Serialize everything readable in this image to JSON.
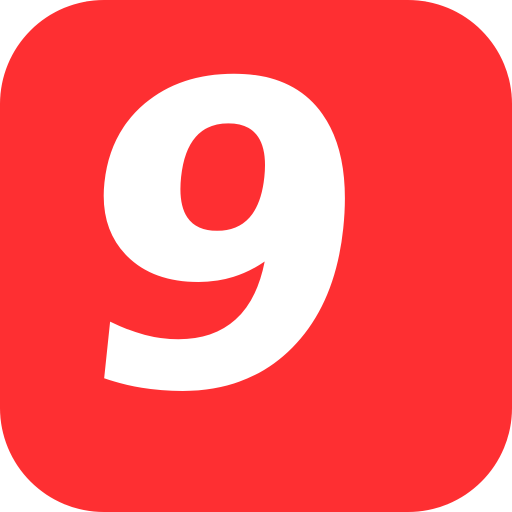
{
  "icon": {
    "name": "number-nine-icon",
    "digit": "9",
    "background_color": "#fe2f32",
    "digit_color": "#ffffff"
  }
}
